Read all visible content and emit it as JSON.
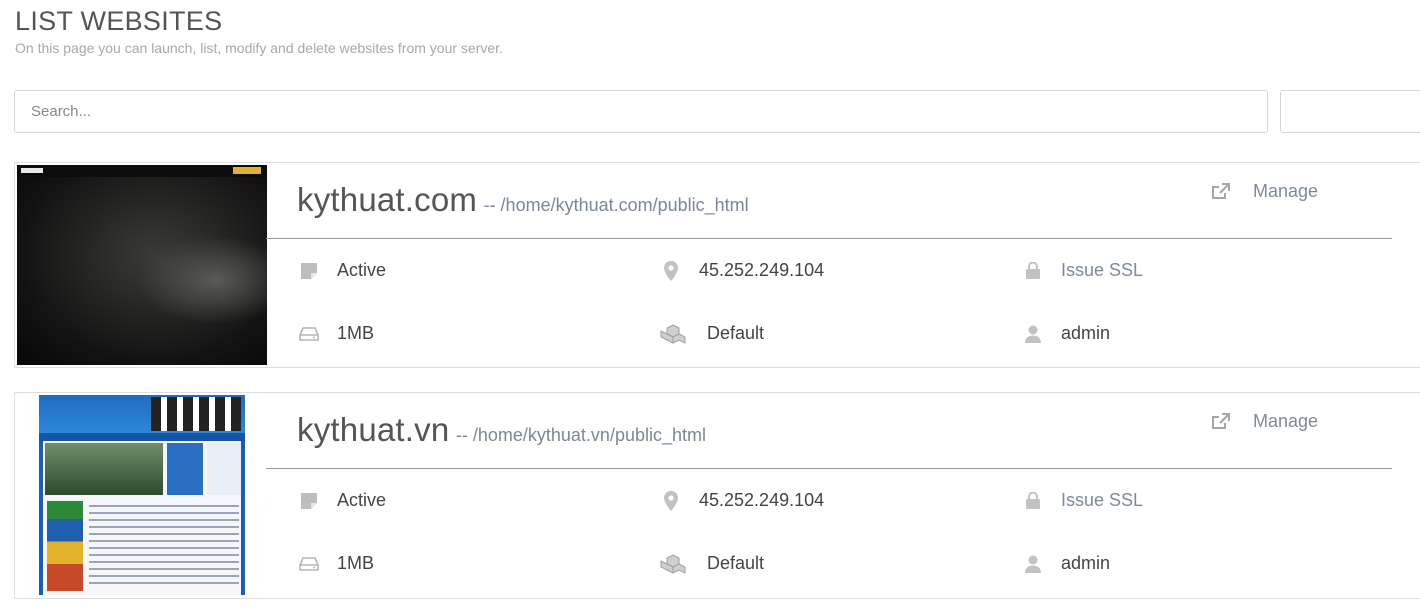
{
  "page": {
    "title": "LIST WEBSITES",
    "subtitle": "On this page you can launch, list, modify and delete websites from your server."
  },
  "search": {
    "placeholder": "Search..."
  },
  "websites": [
    {
      "domain": "kythuat.com",
      "path": "-- /home/kythuat.com/public_html",
      "manage_label": "Manage",
      "state": "Active",
      "ip": "45.252.249.104",
      "ssl_label": "Issue SSL",
      "disk_usage": "1MB",
      "package": "Default",
      "owner": "admin"
    },
    {
      "domain": "kythuat.vn",
      "path": "-- /home/kythuat.vn/public_html",
      "manage_label": "Manage",
      "state": "Active",
      "ip": "45.252.249.104",
      "ssl_label": "Issue SSL",
      "disk_usage": "1MB",
      "package": "Default",
      "owner": "admin"
    }
  ],
  "icons": {
    "manage": "external-link-icon",
    "state": "sticky-note-icon",
    "ip": "map-marker-icon",
    "ssl": "lock-icon",
    "disk": "hard-drive-icon",
    "package": "cubes-icon",
    "owner": "user-icon"
  },
  "colors": {
    "link": "#7d8b99",
    "icon": "#c2c2c2",
    "divider": "#9a9a9a"
  }
}
